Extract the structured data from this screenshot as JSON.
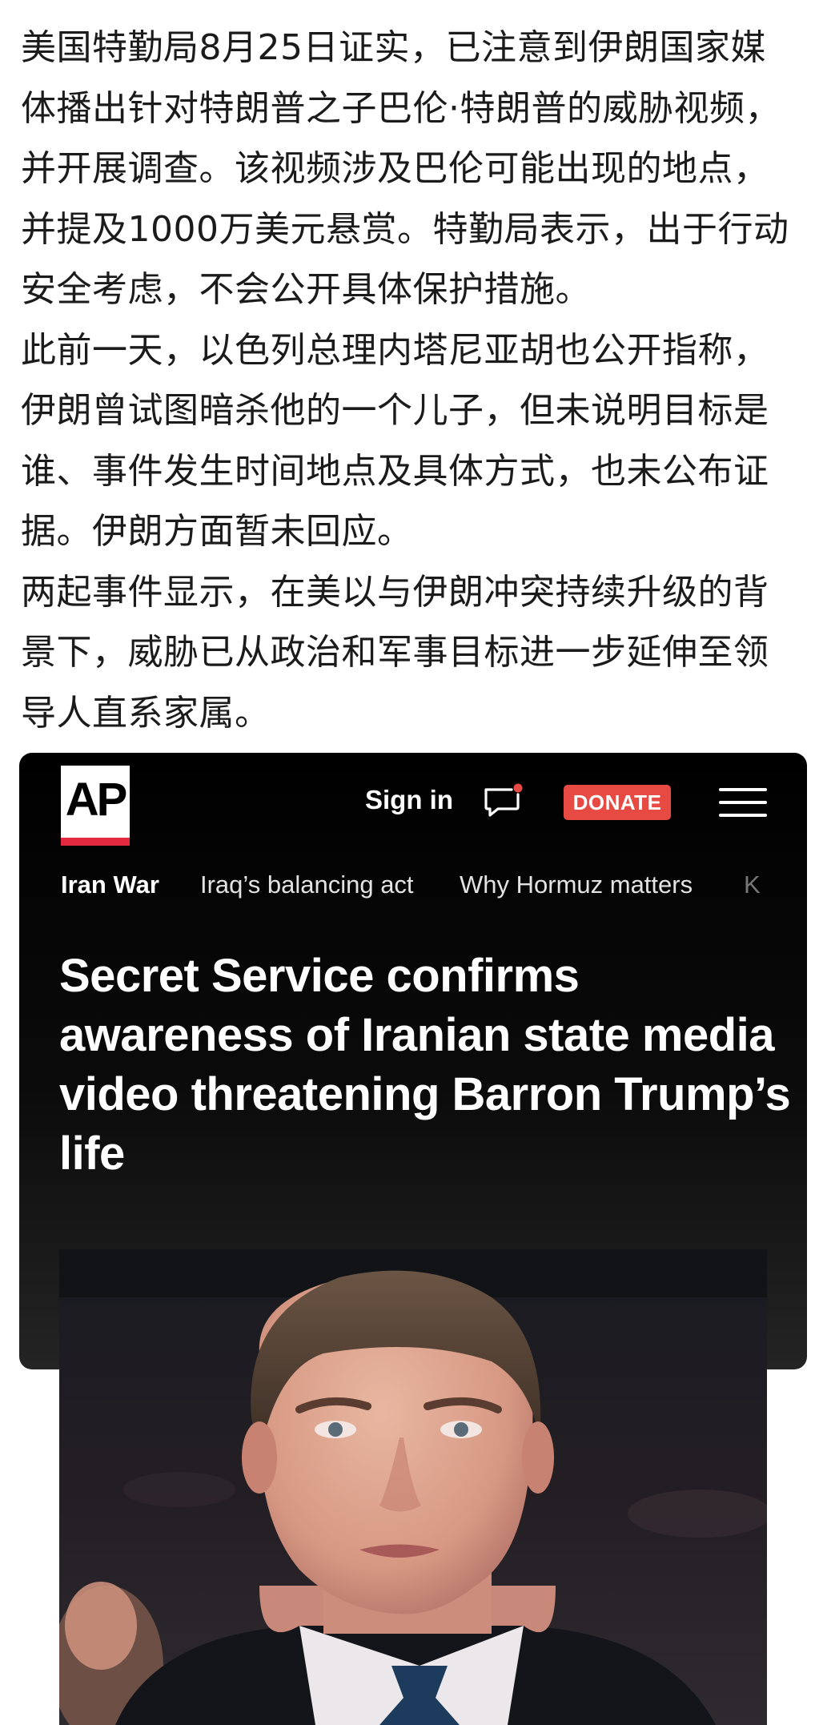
{
  "article": {
    "paragraphs": [
      "美国特勤局8月25日证实，已注意到伊朗国家媒体播出针对特朗普之子巴伦·特朗普的威胁视频，并开展调查。该视频涉及巴伦可能出现的地点，并提及1000万美元悬赏。特勤局表示，出于行动安全考虑，不会公开具体保护措施。",
      "此前一天，以色列总理内塔尼亚胡也公开指称，伊朗曾试图暗杀他的一个儿子，但未说明目标是谁、事件发生时间地点及具体方式，也未公布证据。伊朗方面暂未回应。",
      "两起事件显示，在美以与伊朗冲突持续升级的背景下，威胁已从政治和军事目标进一步延伸至领导人直系家属。"
    ]
  },
  "ap_header": {
    "logo_text": "AP",
    "sign_in": "Sign in",
    "donate": "DONATE",
    "icons": [
      "comment-icon",
      "menu-icon"
    ],
    "colors": {
      "brand_red": "#e2293f",
      "donate_bg": "#e64a42",
      "notification_dot": "#e64a42"
    }
  },
  "nav_tabs": [
    {
      "label": "Iran War",
      "active": true
    },
    {
      "label": "Iraq’s balancing act",
      "active": false
    },
    {
      "label": "Why Hormuz matters",
      "active": false
    },
    {
      "label": "K",
      "active": false
    }
  ],
  "headline": "Secret Service confirms awareness of Iranian state media video threatening Barron Trump’s life"
}
